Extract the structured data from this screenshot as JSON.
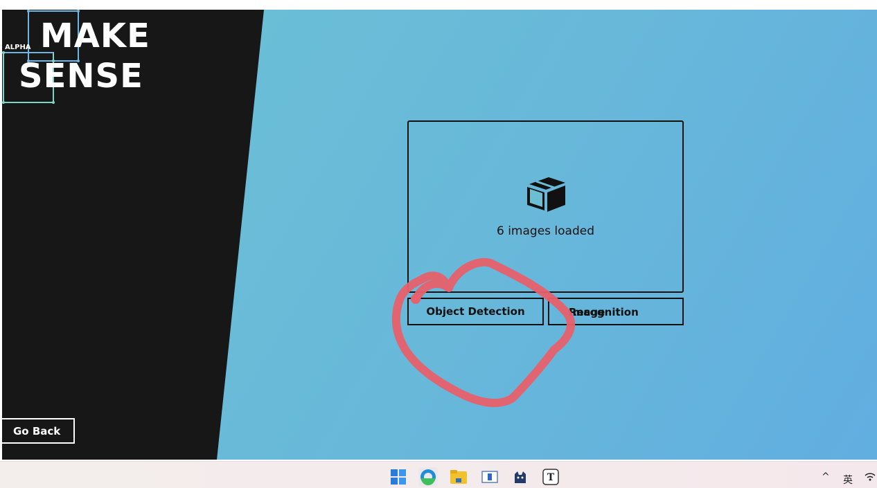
{
  "logo": {
    "line1": "MAKE",
    "line2": "SENSE",
    "badge": "ALPHA"
  },
  "nav": {
    "go_back": "Go Back"
  },
  "dropzone": {
    "icon": "box-icon",
    "status_text": "6 images loaded"
  },
  "modes": {
    "object_detection": "Object Detection",
    "image_recognition_overlap_a": "Image",
    "image_recognition_overlap_b": "Recognition"
  },
  "taskbar": {
    "icons": [
      "windows-start-icon",
      "edge-browser-icon",
      "file-explorer-icon",
      "app-window-icon",
      "cat-app-icon",
      "typora-icon"
    ],
    "tray_chevron": "^",
    "ime_label": "英",
    "wifi_icon": "wifi-icon"
  },
  "colors": {
    "sidebar": "#171717",
    "background_gradient": [
      "#6cc2d3",
      "#61aee0"
    ],
    "annotation_stroke": "#e8606c",
    "logo_frame_blue": "#6fb6e8",
    "logo_frame_teal": "#7fd6c4"
  }
}
